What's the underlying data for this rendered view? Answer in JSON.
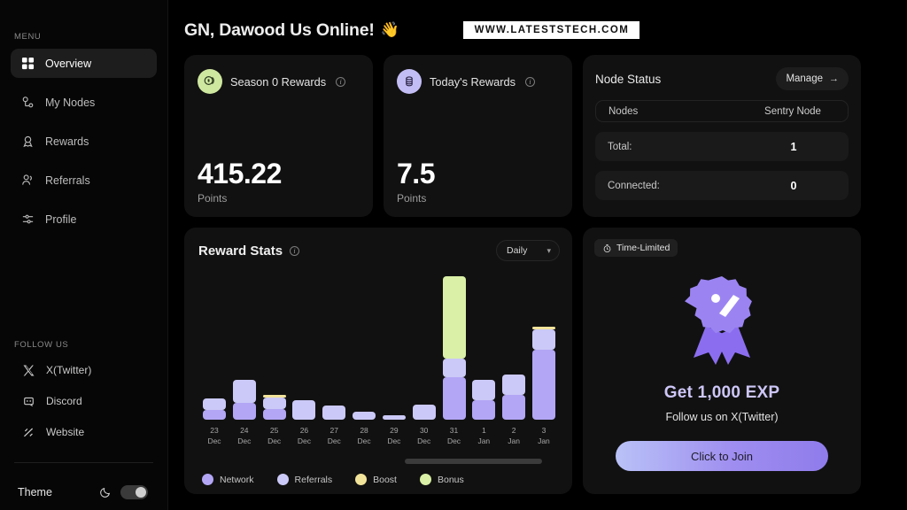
{
  "sidebar": {
    "menu_label": "MENU",
    "items": [
      {
        "label": "Overview",
        "icon": "grid-icon"
      },
      {
        "label": "My Nodes",
        "icon": "node-icon"
      },
      {
        "label": "Rewards",
        "icon": "award-icon"
      },
      {
        "label": "Referrals",
        "icon": "users-icon"
      },
      {
        "label": "Profile",
        "icon": "sliders-icon"
      }
    ],
    "follow_label": "FOLLOW US",
    "social": [
      {
        "label": "X(Twitter)",
        "icon": "x-twitter-icon"
      },
      {
        "label": "Discord",
        "icon": "discord-icon"
      },
      {
        "label": "Website",
        "icon": "website-icon"
      }
    ],
    "theme_label": "Theme",
    "theme_icon": "moon-icon",
    "theme_on": true
  },
  "header": {
    "greeting": "GN, Dawood Us Online!",
    "wave_emoji": "👋",
    "watermark": "WWW.LATESTSTECH.COM"
  },
  "stat_cards": [
    {
      "title": "Season 0 Rewards",
      "value": "415.22",
      "unit": "Points",
      "icon": "coins-icon",
      "icon_bg": "#cfe8a0",
      "info_icon": "info-icon"
    },
    {
      "title": "Today's Rewards",
      "value": "7.5",
      "unit": "Points",
      "icon": "coin-stack-icon",
      "icon_bg": "#c3bdf5",
      "info_icon": "info-icon"
    }
  ],
  "node_status": {
    "title": "Node Status",
    "manage_label": "Manage",
    "manage_arrow": "→",
    "header_row": {
      "label": "Nodes",
      "value": "Sentry Node"
    },
    "rows": [
      {
        "label": "Total:",
        "value": "1"
      },
      {
        "label": "Connected:",
        "value": "0"
      }
    ]
  },
  "reward_stats": {
    "title": "Reward Stats",
    "info_icon": "info-icon",
    "range_selected": "Daily",
    "chevron": "⌄"
  },
  "promo": {
    "chip_label": "Time-Limited",
    "chip_icon": "timer-icon",
    "badge_icon": "ribbon-award-icon",
    "title": "Get 1,000 EXP",
    "subtitle": "Follow us on X(Twitter)",
    "button_label": "Click to Join"
  },
  "colors": {
    "network": "#b3a6f5",
    "referrals": "#cbc9f7",
    "boost": "#f2e39a",
    "bonus": "#d9f0a6",
    "accent": "#9f8ef0",
    "card_bg": "#111111"
  },
  "chart_data": {
    "type": "bar",
    "title": "Reward Stats",
    "stacked": true,
    "xlabel": "",
    "ylabel": "",
    "ylim": [
      0,
      190
    ],
    "grid": false,
    "legend_position": "bottom-left",
    "range": "Daily",
    "categories": [
      "23 Dec",
      "24 Dec",
      "25 Dec",
      "26 Dec",
      "27 Dec",
      "28 Dec",
      "29 Dec",
      "30 Dec",
      "31 Dec",
      "1 Jan",
      "2 Jan",
      "3 Jan"
    ],
    "category_day": [
      "23",
      "24",
      "25",
      "26",
      "27",
      "28",
      "29",
      "30",
      "31",
      "1",
      "2",
      "3"
    ],
    "category_month": [
      "Dec",
      "Dec",
      "Dec",
      "Dec",
      "Dec",
      "Dec",
      "Dec",
      "Dec",
      "Dec",
      "Jan",
      "Jan",
      "Jan"
    ],
    "series": [
      {
        "name": "Network",
        "color": "#b3a6f5",
        "values": [
          12,
          21,
          13,
          0,
          0,
          0,
          0,
          0,
          53,
          24,
          31,
          87
        ]
      },
      {
        "name": "Referrals",
        "color": "#cbc9f7",
        "values": [
          14,
          29,
          14,
          24,
          18,
          10,
          5,
          19,
          23,
          25,
          25,
          25
        ]
      },
      {
        "name": "Boost",
        "color": "#f2e39a",
        "values": [
          0,
          0,
          2,
          0,
          0,
          0,
          0,
          0,
          0,
          0,
          0,
          3
        ]
      },
      {
        "name": "Bonus",
        "color": "#d9f0a6",
        "values": [
          0,
          0,
          0,
          0,
          0,
          0,
          0,
          0,
          102,
          0,
          0,
          0
        ]
      }
    ],
    "scrollbar": {
      "visible": true,
      "thumb_start_pct": 57,
      "thumb_width_pct": 38
    }
  }
}
